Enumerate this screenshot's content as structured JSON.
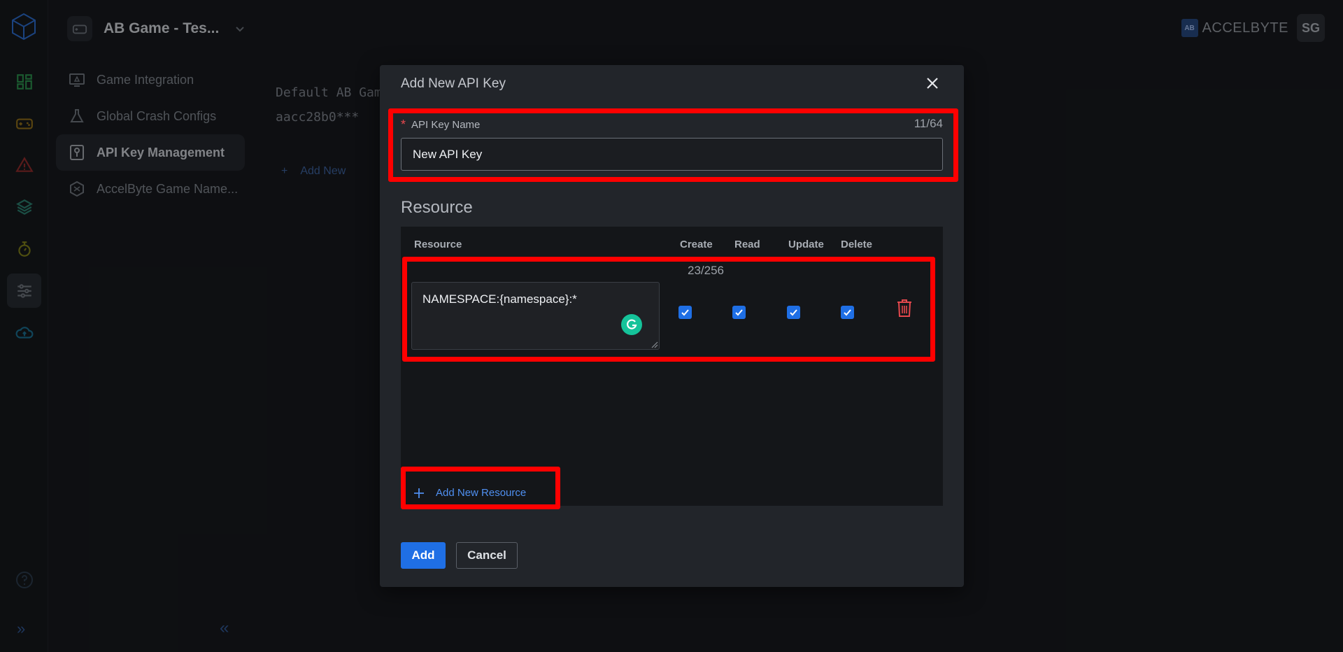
{
  "app": {
    "game_name": "AB Game - Tes...",
    "brand_name": "ACCELBYTE",
    "brand_mark": "AB",
    "user_initials": "SG"
  },
  "rail": {
    "icons": [
      "dashboard-icon",
      "game-controller-icon",
      "alert-icon",
      "layers-icon",
      "stopwatch-icon",
      "sliders-icon",
      "cloud-upload-icon"
    ],
    "active": "sliders-icon",
    "help_icon": "question-icon",
    "expand_glyph": "»"
  },
  "subnav": {
    "items": [
      {
        "label": "Game Integration",
        "icon": "monitor-icon"
      },
      {
        "label": "Global Crash Configs",
        "icon": "flask-icon"
      },
      {
        "label": "API Key Management",
        "icon": "key-icon",
        "active": true
      },
      {
        "label": "AccelByte Game Name...",
        "icon": "hexagon-icon"
      }
    ],
    "collapse_glyph": "«"
  },
  "background_content": {
    "key_name": "Default AB Gam",
    "key_value": "aacc28b0***",
    "add_new_label": "Add New"
  },
  "modal": {
    "title": "Add New API Key",
    "name_field": {
      "label": "API Key Name",
      "required_mark": "*",
      "value": "New API Key",
      "counter": "11/64"
    },
    "resource_section_title": "Resource",
    "table": {
      "headers": [
        "Resource",
        "Create",
        "Read",
        "Update",
        "Delete"
      ],
      "rows": [
        {
          "resource": "NAMESPACE:{namespace}:*",
          "counter": "23/256",
          "create": true,
          "read": true,
          "update": true,
          "delete": true
        }
      ]
    },
    "add_resource_label": "Add New Resource",
    "add_button": "Add",
    "cancel_button": "Cancel"
  },
  "colors": {
    "accent": "#1f6fe5",
    "highlight": "#ff0000",
    "danger": "#e5484d",
    "grammarly": "#15c39a"
  }
}
